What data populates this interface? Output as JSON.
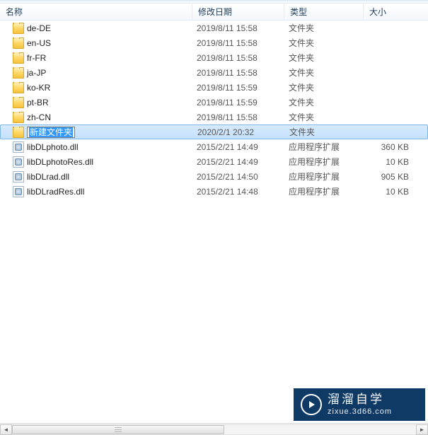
{
  "columns": {
    "name": "名称",
    "date": "修改日期",
    "type": "类型",
    "size": "大小"
  },
  "rows": [
    {
      "icon": "folder",
      "name": "de-DE",
      "date": "2019/8/11 15:58",
      "type": "文件夹",
      "size": "",
      "selected": false,
      "renaming": false
    },
    {
      "icon": "folder",
      "name": "en-US",
      "date": "2019/8/11 15:58",
      "type": "文件夹",
      "size": "",
      "selected": false,
      "renaming": false
    },
    {
      "icon": "folder",
      "name": "fr-FR",
      "date": "2019/8/11 15:58",
      "type": "文件夹",
      "size": "",
      "selected": false,
      "renaming": false
    },
    {
      "icon": "folder",
      "name": "ja-JP",
      "date": "2019/8/11 15:58",
      "type": "文件夹",
      "size": "",
      "selected": false,
      "renaming": false
    },
    {
      "icon": "folder",
      "name": "ko-KR",
      "date": "2019/8/11 15:59",
      "type": "文件夹",
      "size": "",
      "selected": false,
      "renaming": false
    },
    {
      "icon": "folder",
      "name": "pt-BR",
      "date": "2019/8/11 15:59",
      "type": "文件夹",
      "size": "",
      "selected": false,
      "renaming": false
    },
    {
      "icon": "folder",
      "name": "zh-CN",
      "date": "2019/8/11 15:58",
      "type": "文件夹",
      "size": "",
      "selected": false,
      "renaming": false
    },
    {
      "icon": "folder",
      "name": "新建文件夹",
      "date": "2020/2/1 20:32",
      "type": "文件夹",
      "size": "",
      "selected": true,
      "renaming": true
    },
    {
      "icon": "dll",
      "name": "libDLphoto.dll",
      "date": "2015/2/21 14:49",
      "type": "应用程序扩展",
      "size": "360 KB",
      "selected": false,
      "renaming": false
    },
    {
      "icon": "dll",
      "name": "libDLphotoRes.dll",
      "date": "2015/2/21 14:49",
      "type": "应用程序扩展",
      "size": "10 KB",
      "selected": false,
      "renaming": false
    },
    {
      "icon": "dll",
      "name": "libDLrad.dll",
      "date": "2015/2/21 14:50",
      "type": "应用程序扩展",
      "size": "905 KB",
      "selected": false,
      "renaming": false
    },
    {
      "icon": "dll",
      "name": "libDLradRes.dll",
      "date": "2015/2/21 14:48",
      "type": "应用程序扩展",
      "size": "10 KB",
      "selected": false,
      "renaming": false
    }
  ],
  "watermark": {
    "title": "溜溜自学",
    "url": "zixue.3d66.com"
  }
}
